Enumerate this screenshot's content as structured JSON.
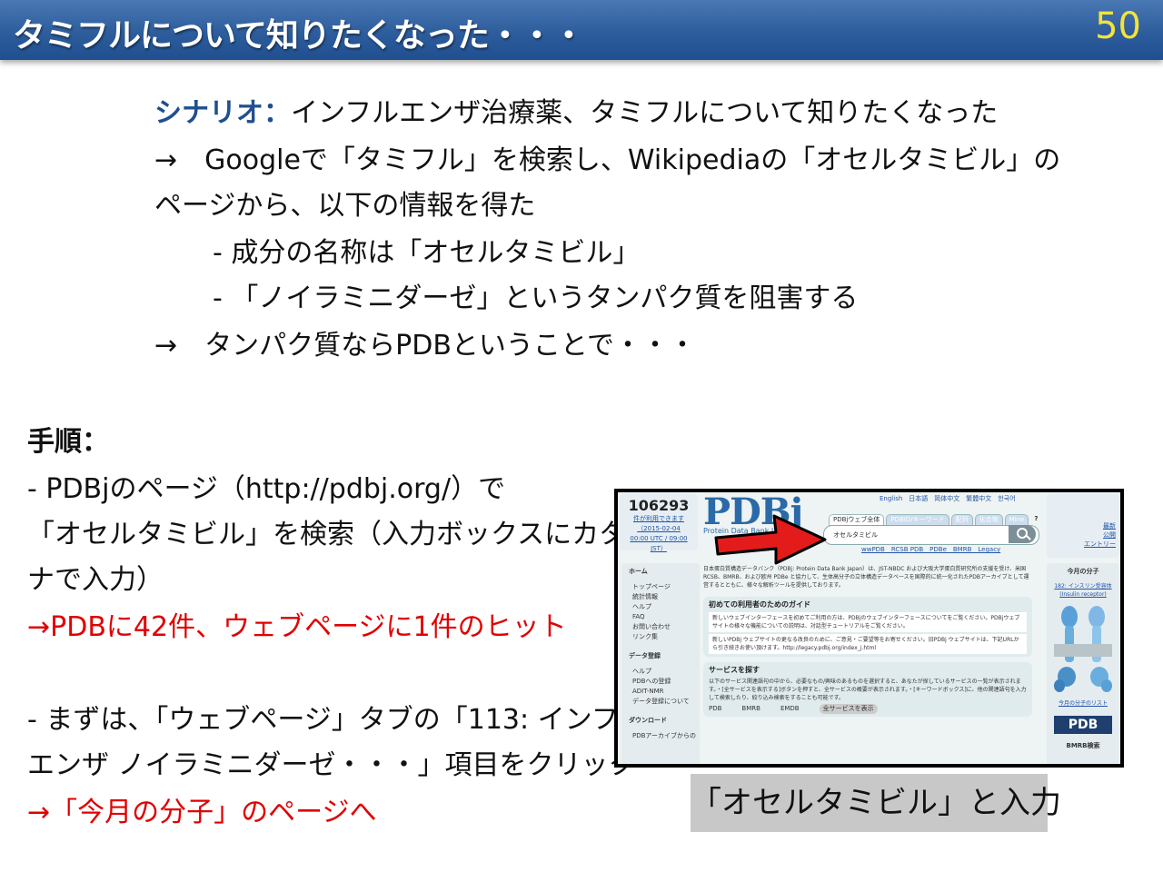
{
  "header": {
    "title": "タミフルについて知りたくなった・・・",
    "page_number": "50"
  },
  "scenario": {
    "label": "シナリオ：",
    "line1": "インフルエンザ治療薬、タミフルについて知りたくなった",
    "line2": "→　Googleで「タミフル」を検索し、Wikipediaの「オセルタミビル」の",
    "line3": "ページから、以下の情報を得た",
    "line4": "- 成分の名称は「オセルタミビル」",
    "line5": "- 「ノイラミニダーゼ」というタンパク質を阻害する",
    "line6": "→　タンパク質ならPDBということで・・・"
  },
  "steps": {
    "heading": "手順：",
    "l1": "- PDBjのページ（http://pdbj.org/）で",
    "l2": "「オセルタミビル」を検索（入力ボックスにカタカ",
    "l3": "ナで入力）",
    "l4": "→PDBに42件、ウェブページに1件のヒット",
    "l5": "- まずは、「ウェブページ」タブの「113: インフル",
    "l6": "エンザ ノイラミニダーゼ・・・」項目をクリック",
    "l7": "→「今月の分子」のページへ"
  },
  "screenshot": {
    "count": "106293",
    "count_note1": "件が利用できます",
    "count_note2": "（2015-02-04",
    "count_note3": "00:00 UTC / 09:00",
    "count_note4": "JST）",
    "lang_links": "English　日本語　简体中文　繁體中文　한국어",
    "logo": "PDBj",
    "logo_sub": "Protein Data Bank Japan",
    "tabs": [
      "PDBjウェブ全体",
      "PDBID/キーワード",
      "配列",
      "化合物",
      "Mine",
      "?"
    ],
    "search_value": "オセルタミビル",
    "sub_links": "wwPDB　RCSB PDB　PDBe　BMRB　Legacy",
    "right_top": [
      "最新",
      "公開",
      "エントリー"
    ],
    "sidebar_home": "ホーム",
    "sidebar_home_items": [
      "トップページ",
      "統計情報",
      "ヘルプ",
      "FAQ",
      "お問い合わせ",
      "リンク集"
    ],
    "sidebar_data": "データ登録",
    "sidebar_data_items": [
      "ヘルプ",
      "PDBへの登録",
      "ADIT-NMR",
      "データ登録について"
    ],
    "sidebar_dl": "ダウンロード",
    "sidebar_dl_items": [
      "PDBアーカイブからの"
    ],
    "intro": "日本蛋白質構造データバンク（PDBj: Protein Data Bank Japan）は、JST-NBDC および大阪大学蛋白質研究所の支援を受け、米国 RCSB、BMRB、および欧州 PDBe と協力して、生体高分子の立体構造データベースを国際的に統一化されたPDBアーカイブとして運営するとともに、様々な解析ツールを提供しております。",
    "guide_title": "初めての利用者のためのガイド",
    "guide_text1": "新しいウェブインターフェースを初めてご利用の方は、PDBjのウェブインターフェースについてをご覧ください。PDBjウェブサイトの様々な機能についての説明は、対話型チュートリアルをご覧ください。",
    "guide_text2": "新しいPDBj ウェブサイトの更なる改良のために、ご意見・ご要望等をお寄せください。旧PDBj ウェブサイトは、下記URLから引き続きお使い頂けます。http://legacy.pdbj.org/index_j.html",
    "service_title": "サービスを探す",
    "service_text": "以下のサービス関連語句の中から、必要なもの/興味のあるものを選択すると、あなたが探しているサービスの一覧が表示されます。・[全サービスを表示する]ボタンを押すと、全サービスの概要が表示されます。・[キーワードボックス]に、他の関連語句を入力して検索したり、絞り込み検索をすることも可能です。",
    "service_options": [
      "PDB",
      "BMRB",
      "EMDB",
      "全サービスを表示"
    ],
    "right_title": "今月の分子",
    "right_link": "182: インスリン受容体 (Insulin receptor)",
    "right_link2": "今月の分子のリスト",
    "right_logo": "PDB",
    "right_bmrb": "BMRB検索"
  },
  "caption": "「オセルタミビル」と入力",
  "colors": {
    "header": "#2d5d9c",
    "page_number": "#f5e23a",
    "accent_blue": "#1f4f8f",
    "highlight_red": "#e00000",
    "arrow_red": "#e41b1b"
  }
}
